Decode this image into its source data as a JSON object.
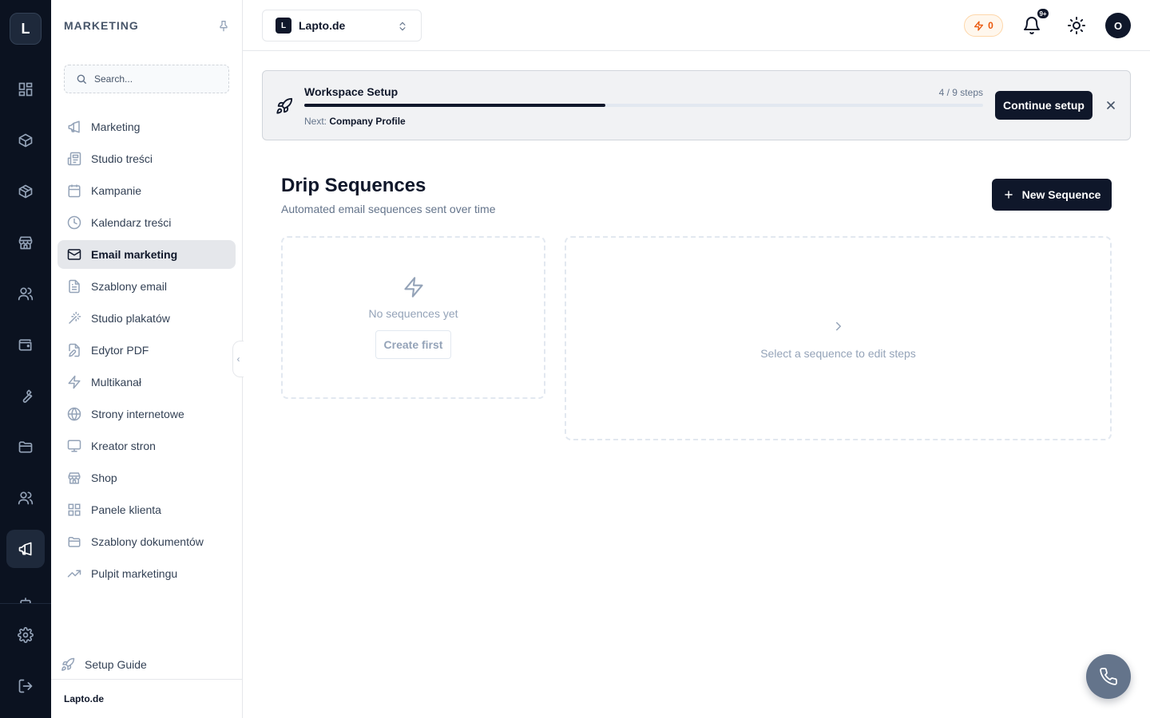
{
  "rail": {
    "logo_letter": "L",
    "items": [
      {
        "icon": "grid-icon"
      },
      {
        "icon": "box-icon"
      },
      {
        "icon": "package-icon"
      },
      {
        "icon": "store-icon"
      },
      {
        "icon": "users-icon"
      },
      {
        "icon": "wallet-icon"
      },
      {
        "icon": "wrench-icon"
      },
      {
        "icon": "folder-icon"
      },
      {
        "icon": "team-icon"
      },
      {
        "icon": "megaphone-icon",
        "active": true
      },
      {
        "icon": "robot-icon"
      },
      {
        "icon": "gear-icon"
      },
      {
        "icon": "logout-icon"
      }
    ]
  },
  "sidebar": {
    "title": "MARKETING",
    "search_placeholder": "Search...",
    "items": [
      {
        "label": "Marketing",
        "icon": "megaphone-icon"
      },
      {
        "label": "Studio treści",
        "icon": "newspaper-icon"
      },
      {
        "label": "Kampanie",
        "icon": "calendar-icon"
      },
      {
        "label": "Kalendarz treści",
        "icon": "clock-icon"
      },
      {
        "label": "Email marketing",
        "icon": "mail-icon",
        "active": true
      },
      {
        "label": "Szablony email",
        "icon": "file-text-icon"
      },
      {
        "label": "Studio plakatów",
        "icon": "wand-icon"
      },
      {
        "label": "Edytor PDF",
        "icon": "file-edit-icon"
      },
      {
        "label": "Multikanał",
        "icon": "zap-icon"
      },
      {
        "label": "Strony internetowe",
        "icon": "globe-icon"
      },
      {
        "label": "Kreator stron",
        "icon": "monitor-icon"
      },
      {
        "label": "Shop",
        "icon": "store-icon"
      },
      {
        "label": "Panele klienta",
        "icon": "grid-icon"
      },
      {
        "label": "Szablony dokumentów",
        "icon": "folder-icon"
      },
      {
        "label": "Pulpit marketingu",
        "icon": "trending-up-icon"
      }
    ],
    "setup_guide": "Setup Guide",
    "footer": "Lapto.de"
  },
  "topbar": {
    "workspace_badge": "L",
    "workspace_name": "Lapto.de",
    "credits": "0",
    "notifications_badge": "9+",
    "avatar_letter": "O"
  },
  "banner": {
    "title": "Workspace Setup",
    "steps": "4 / 9 steps",
    "progress": 0.444,
    "next_label": "Next:",
    "next_value": "Company Profile",
    "continue_label": "Continue setup"
  },
  "main": {
    "title": "Drip Sequences",
    "subtitle": "Automated email sequences sent over time",
    "new_button": "New Sequence",
    "empty_text": "No sequences yet",
    "create_first": "Create first",
    "select_hint": "Select a sequence to edit steps"
  },
  "colors": {
    "rail_bg": "#0b1220",
    "primary": "#0f172a",
    "muted": "#94a3b8",
    "credits": "#ea580c"
  }
}
